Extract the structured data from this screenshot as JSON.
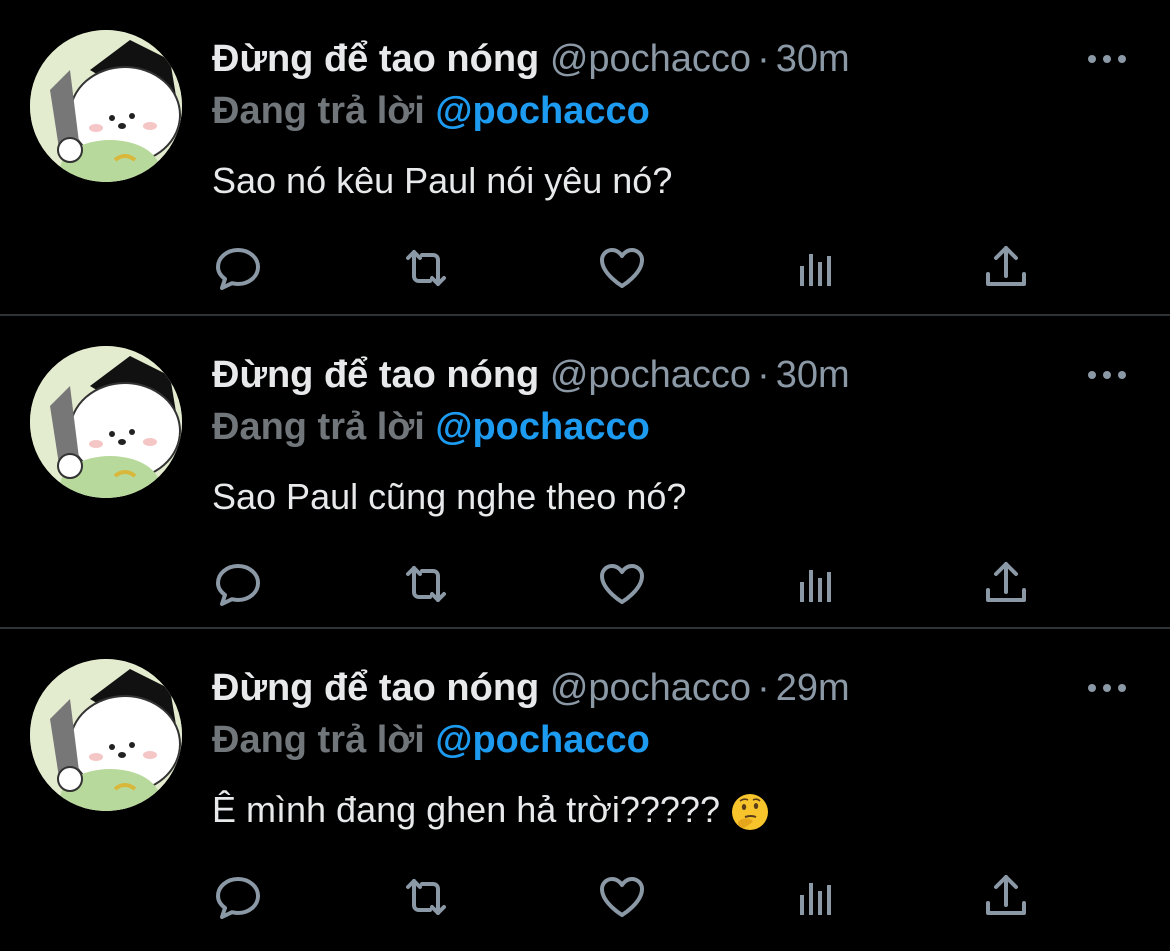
{
  "tweets": [
    {
      "name": "Đừng để tao nóng",
      "handle": "@pochacco",
      "separator": "·",
      "time": "30m",
      "replying_label": "Đang trả lời",
      "replying_to": "@pochacco",
      "text": "Sao nó kêu Paul nói yêu nó?"
    },
    {
      "name": "Đừng để tao nóng",
      "handle": "@pochacco",
      "separator": "·",
      "time": "30m",
      "replying_label": "Đang trả lời",
      "replying_to": "@pochacco",
      "text": "Sao Paul cũng nghe theo nó?"
    },
    {
      "name": "Đừng để tao nóng",
      "handle": "@pochacco",
      "separator": "·",
      "time": "29m",
      "replying_label": "Đang trả lời",
      "replying_to": "@pochacco",
      "text": "Ê mình đang ghen hả trời?????",
      "emoji": "thinking-face"
    }
  ],
  "icons": {
    "actions": [
      "reply-icon",
      "retweet-icon",
      "like-icon",
      "analytics-icon",
      "share-icon"
    ],
    "more": "more-options-icon",
    "avatar": "pochacco-avatar"
  },
  "colors": {
    "background": "#000000",
    "text": "#e7e9ea",
    "muted": "#8b98a5",
    "accent": "#1d9bf0",
    "divider": "#2f3336"
  }
}
